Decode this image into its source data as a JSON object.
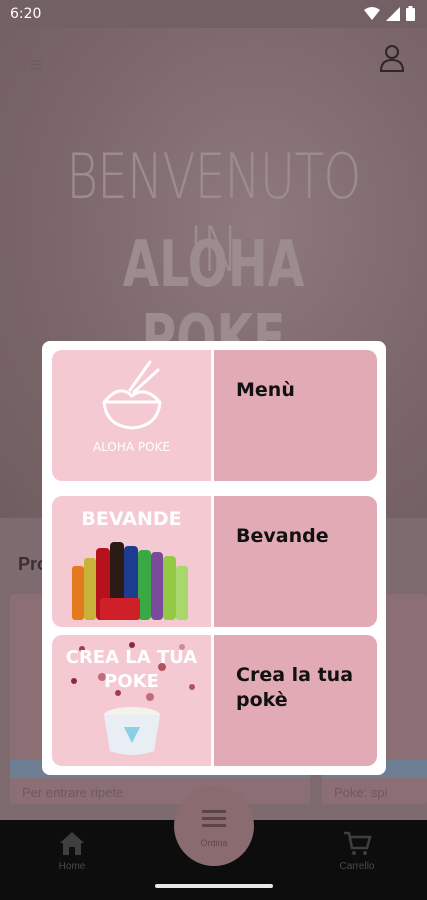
{
  "status_bar": {
    "time": "6:20"
  },
  "background": {
    "hero_line1": "BENVENUTO IN",
    "hero_line2": "ALOHA POKE",
    "section_title": "Pro",
    "card_left_text": "Per entrare ripete",
    "card_right_text": "Poke: spi"
  },
  "dialog": {
    "options": [
      {
        "label": "Menù",
        "thumb_caption": "ALOHA POKE"
      },
      {
        "label": "Bevande",
        "thumb_caption": "BEVANDE"
      },
      {
        "label": "Crea la tua pokè",
        "thumb_caption_1": "CREA LA TUA",
        "thumb_caption_2": "POKE"
      }
    ]
  },
  "bottom_nav": {
    "home_label": "Home",
    "center_label": "Ordina",
    "cart_label": "Carrello"
  },
  "colors": {
    "option_label_bg": "#e2aab5",
    "option_thumb_bg": "#f4c9d2",
    "scrim": "#7e6b6f"
  }
}
